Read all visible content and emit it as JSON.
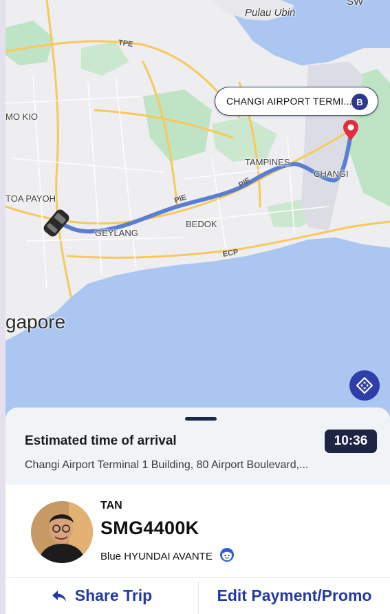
{
  "map": {
    "place_labels": {
      "pulau_ubin": "Pulau Ubin",
      "mo_kio": "MO KIO",
      "toa_payoh": "TOA PAYOH",
      "geylang": "GEYLANG",
      "bedok": "BEDOK",
      "tampines": "TAMPINES",
      "changi": "CHANGI",
      "singapore": "gapore",
      "top_right": "SW"
    },
    "road_labels": {
      "tpe": "TPE",
      "pie_1": "PIE",
      "pie_2": "PIE",
      "ecp": "ECP"
    },
    "destination_chip": {
      "text": "CHANGI AIRPORT TERMI...",
      "badge": "B"
    },
    "recenter_icon": "recenter-icon"
  },
  "eta": {
    "title": "Estimated time of arrival",
    "time": "10:36",
    "address": "Changi Airport Terminal 1 Building, 80 Airport Boulevard,..."
  },
  "driver": {
    "name": "TAN",
    "plate": "SMG4400K",
    "car": "Blue HYUNDAI AVANTE"
  },
  "actions": {
    "share": "Share Trip",
    "edit": "Edit Payment/Promo"
  },
  "colors": {
    "accent": "#2339a8",
    "eta_badge": "#1d2444",
    "route": "#5b7fd0",
    "water": "#aac6f1",
    "land": "#eeedf0",
    "park": "#bfe3c5"
  }
}
